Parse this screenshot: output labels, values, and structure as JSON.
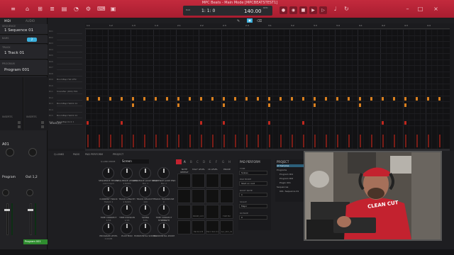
{
  "app": {
    "window_title": "MPC Beats - Main Mode [MPCBEATSTEST1]"
  },
  "transport": {
    "bar_position": "1: 1: 0",
    "tempo": "140.00",
    "tempo_unit": "BPM"
  },
  "left_panel": {
    "tabs": [
      "MIDI",
      "AUDIO"
    ],
    "sequence_label": "SEQUENCE",
    "sequence_name": "1 Sequence 01",
    "bars_label": "BARS",
    "bars_value": "2",
    "track_label": "TRACK",
    "track_name": "1 Track 01",
    "program_label": "PROGRAM",
    "program_name": "Program 001",
    "inserts_label": "INSERTS",
    "pad_label": "A01",
    "channel_labels": [
      "Program",
      "Out 1,2"
    ],
    "channel_bottom": [
      "Program 001"
    ]
  },
  "grid": {
    "tabs": [
      "GRID",
      "WAVE",
      "LIST"
    ],
    "ruler_ticks": [
      "1.1",
      "1.2",
      "1.3",
      "1.4",
      "2.1",
      "2.2",
      "2.3",
      "2.4",
      "3.1",
      "3.2",
      "3.3",
      "3.4",
      "4.1",
      "4.2",
      "4.3",
      "4.4"
    ],
    "track_rows": [
      {
        "num": "B01",
        "name": ""
      },
      {
        "num": "B02",
        "name": ""
      },
      {
        "num": "B03",
        "name": ""
      },
      {
        "num": "B04",
        "name": ""
      },
      {
        "num": "B05",
        "name": ""
      },
      {
        "num": "B06",
        "name": ""
      },
      {
        "num": "B07",
        "name": ""
      },
      {
        "num": "B08",
        "name": ""
      },
      {
        "num": "B09",
        "name": "BoomBap Hat 2FN"
      },
      {
        "num": "B10",
        "name": ""
      },
      {
        "num": "B11",
        "name": "Snarefier (000) H01"
      },
      {
        "num": "B12",
        "name": ""
      },
      {
        "num": "B13",
        "name": "BoomBap Hat01 01"
      },
      {
        "num": "B14",
        "name": ""
      },
      {
        "num": "B15",
        "name": "BoomBap Hat01 01"
      },
      {
        "num": "B16",
        "name": "BoomBap Kick 1"
      }
    ],
    "velocity_label": "VELOCITY"
  },
  "lower": {
    "tabs": [
      "Q-LINKS",
      "PADS",
      "PAD PERFORM",
      "PROJECT"
    ],
    "qlink_mode_label": "Q-LINK MODE",
    "qlink_mode_value": "Screen",
    "knobs": [
      {
        "label": "SEQUENCE TEMPO",
        "value": "140.0 bpm"
      },
      {
        "label": "SEQUENCE LENGTH",
        "value": "2 BARS"
      },
      {
        "label": "SEQUENCE LOOP START",
        "value": "Bar 1"
      },
      {
        "label": "SEQUENCE LOOP END",
        "value": "Bar 2"
      },
      {
        "label": "CURRENT TRACK",
        "value": "TRACK 1"
      },
      {
        "label": "TRACK LENGTH",
        "value": "2 BARS"
      },
      {
        "label": "TRACK VELOCITY",
        "value": "100"
      },
      {
        "label": "TRACK TRANSPOSE",
        "value": "0"
      },
      {
        "label": "TIME CORRECT",
        "value": "1/16"
      },
      {
        "label": "TIME DIVISION",
        "value": "1/16"
      },
      {
        "label": "SWING",
        "value": "50%"
      },
      {
        "label": "TIME CORRECT STRENGTH",
        "value": "100%"
      },
      {
        "label": "PROGRAM LEVEL",
        "value": "0.00dB"
      },
      {
        "label": "PLAYHEAD",
        "value": ""
      },
      {
        "label": "HORIZONTAL SCROLL",
        "value": ""
      },
      {
        "label": "HORIZONTAL ZOOM",
        "value": ""
      }
    ],
    "pad_bank_letters": [
      "A",
      "B",
      "C",
      "D",
      "E",
      "F",
      "G",
      "H"
    ],
    "pad_controls": [
      "NOTE REPEAT",
      "HALF LEVEL",
      "16 LEVEL",
      "ERASE"
    ],
    "pad_labels": [
      "",
      "",
      "",
      "",
      "",
      "",
      "",
      "",
      "",
      "BOOM_4.33",
      "",
      "TOM HI2",
      "",
      "Hat Kick M",
      "Hat 2 Kick 01",
      "Aux_Kick_01"
    ],
    "pad_perform": {
      "title": "PAD PERFORM",
      "type_label": "TYPE",
      "type_value": "Scales",
      "pad_mode_label": "PAD MODE",
      "pad_mode_value": "Start on root",
      "root_note_label": "ROOT NOTE",
      "root_note_value": "C",
      "scale_label": "SCALE",
      "scale_value": "Major",
      "octave_label": "OCTAVE",
      "octave_value": "0"
    },
    "project": {
      "title": "PROJECT",
      "items": [
        "All Samples",
        "Programs",
        "Program 001",
        "Program 002",
        "Plugin 001",
        "Sequences",
        "001: Sequence 01"
      ]
    }
  },
  "webcam": {
    "shirt_text": "CLEAN CUT"
  },
  "colors": {
    "title_bar": "#b7223a",
    "note_orange": "#d9801f",
    "note_red": "#c0281f",
    "accent_blue": "#3bb0dc"
  }
}
